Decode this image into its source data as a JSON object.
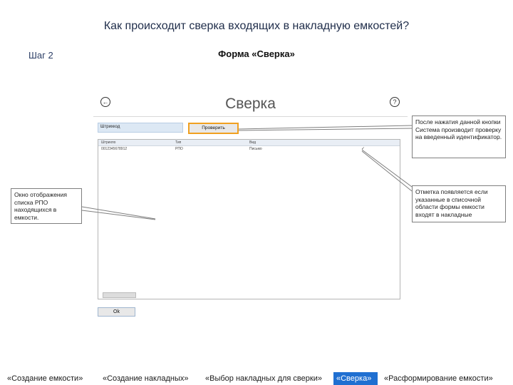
{
  "slide": {
    "title": "Как происходит сверка входящих в накладную емкостей?",
    "step": "Шаг 2",
    "form_title": "Форма «Сверка»"
  },
  "window": {
    "title": "Сверка",
    "back_icon": "arrow-left-icon",
    "help_icon": "question-icon",
    "identifier_label": "Штрихкод",
    "check_button": "Проверить",
    "grid": {
      "columns": [
        "Штрихпо",
        "Тип",
        "Вид"
      ],
      "rows": [
        {
          "cells": [
            "0012345678912",
            "РПО",
            "Письмо"
          ],
          "checked": true
        }
      ],
      "check_icon": "check-icon"
    },
    "ok_button": "Ok"
  },
  "callouts": {
    "check_button_note": "После нажатия данной кнопки Система производит проверку на введенный идентификатор.",
    "mark_note": "Отметка появляется если указанные в списочной области формы емкости входят в накладные",
    "list_note": "Окно отображения списка РПО находящихся в емкости."
  },
  "breadcrumb": [
    {
      "label": "«Создание емкости»",
      "active": false
    },
    {
      "label": "«Создание накладных»",
      "active": false
    },
    {
      "label": "«Выбор накладных для сверки»",
      "active": false
    },
    {
      "label": "«Сверка»",
      "active": true
    },
    {
      "label": "«Расформирование емкости»",
      "active": false
    }
  ],
  "colors": {
    "accent_border": "#f0a020",
    "active_step": "#1f6fd1",
    "input_bg": "#dce8f4"
  }
}
